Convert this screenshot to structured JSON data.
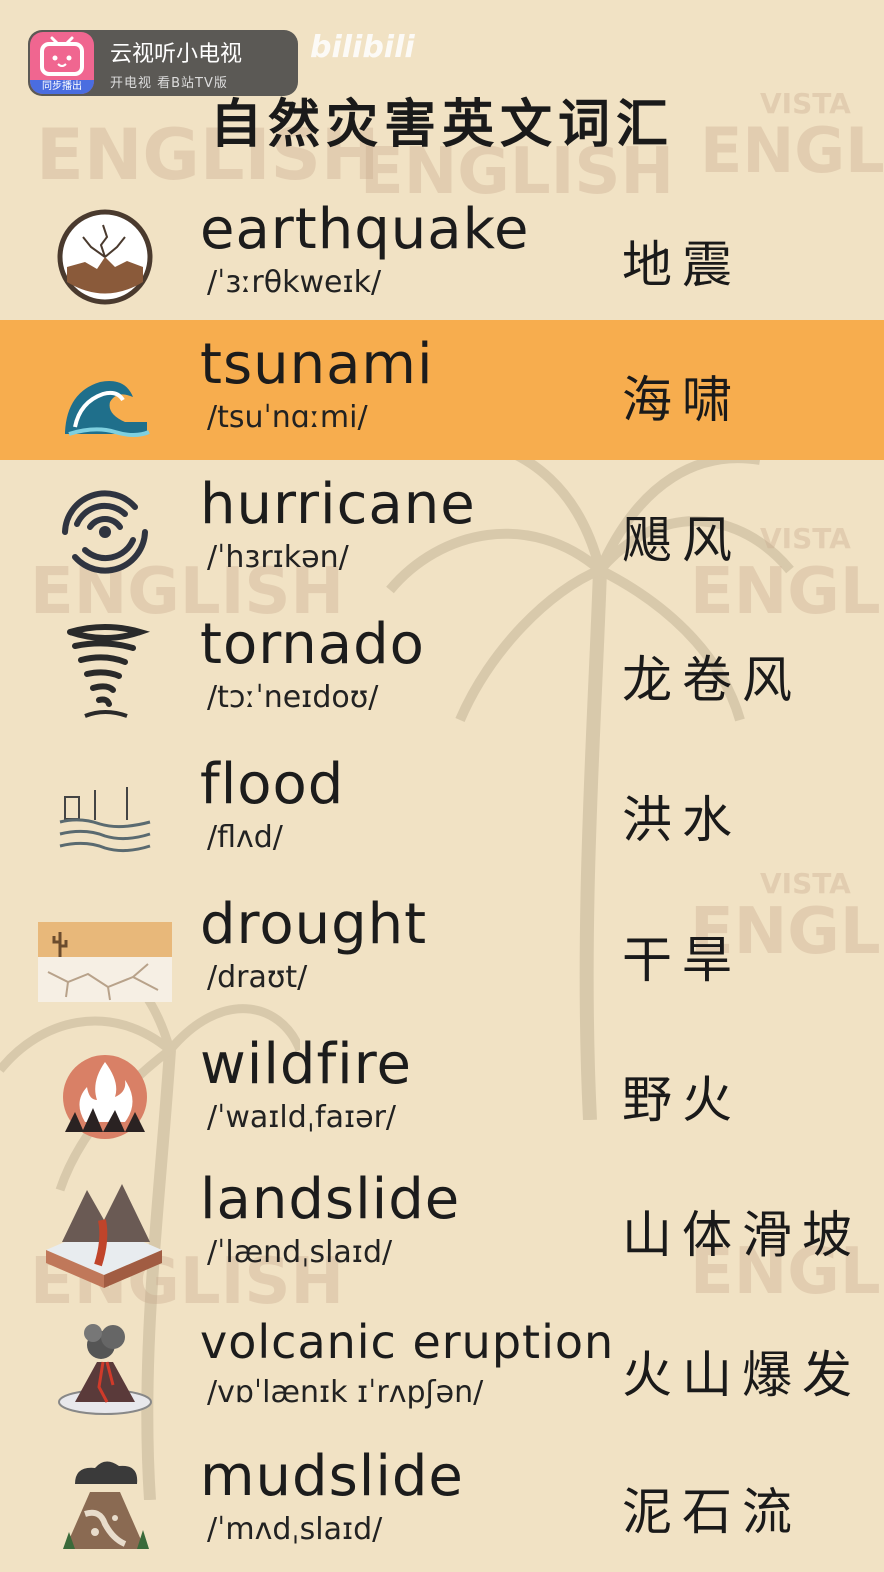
{
  "app_badge": {
    "logo_label": "同步播出",
    "title": "云视听小电视",
    "subtitle": "开电视 看B站TV版"
  },
  "watermark": {
    "site": "bilibili",
    "brand": "ENGLISH",
    "brand_small": "VISTA"
  },
  "title": "自然灾害英文词汇",
  "colors": {
    "background": "#f1e2c4",
    "highlight": "#f7ad4e",
    "text": "#1c1c1c"
  },
  "vocab": [
    {
      "word": "earthquake",
      "ipa": "/ˈɜːrθkweɪk/",
      "cn": "地震",
      "icon": "earthquake-icon"
    },
    {
      "word": "tsunami",
      "ipa": "/tsuˈnɑːmi/",
      "cn": "海啸",
      "icon": "tsunami-wave-icon",
      "highlighted": true
    },
    {
      "word": "hurricane",
      "ipa": "/ˈhɜrɪkən/",
      "cn": "飓风",
      "icon": "hurricane-icon"
    },
    {
      "word": "tornado",
      "ipa": "/tɔːˈneɪdoʊ/",
      "cn": "龙卷风",
      "icon": "tornado-icon"
    },
    {
      "word": "flood",
      "ipa": "/flʌd/",
      "cn": "洪水",
      "icon": "flood-icon"
    },
    {
      "word": "drought",
      "ipa": "/draʊt/",
      "cn": "干旱",
      "icon": "drought-icon"
    },
    {
      "word": "wildfire",
      "ipa": "/ˈwaɪldˌfaɪər/",
      "cn": "野火",
      "icon": "wildfire-icon"
    },
    {
      "word": "landslide",
      "ipa": "/ˈlændˌslaɪd/",
      "cn": "山体滑坡",
      "icon": "landslide-icon"
    },
    {
      "word": "volcanic eruption",
      "ipa": "/vɒˈlænɪk ɪˈrʌpʃən/",
      "cn": "火山爆发",
      "icon": "volcano-icon"
    },
    {
      "word": "mudslide",
      "ipa": "/ˈmʌdˌslaɪd/",
      "cn": "泥石流",
      "icon": "mudslide-icon"
    }
  ]
}
